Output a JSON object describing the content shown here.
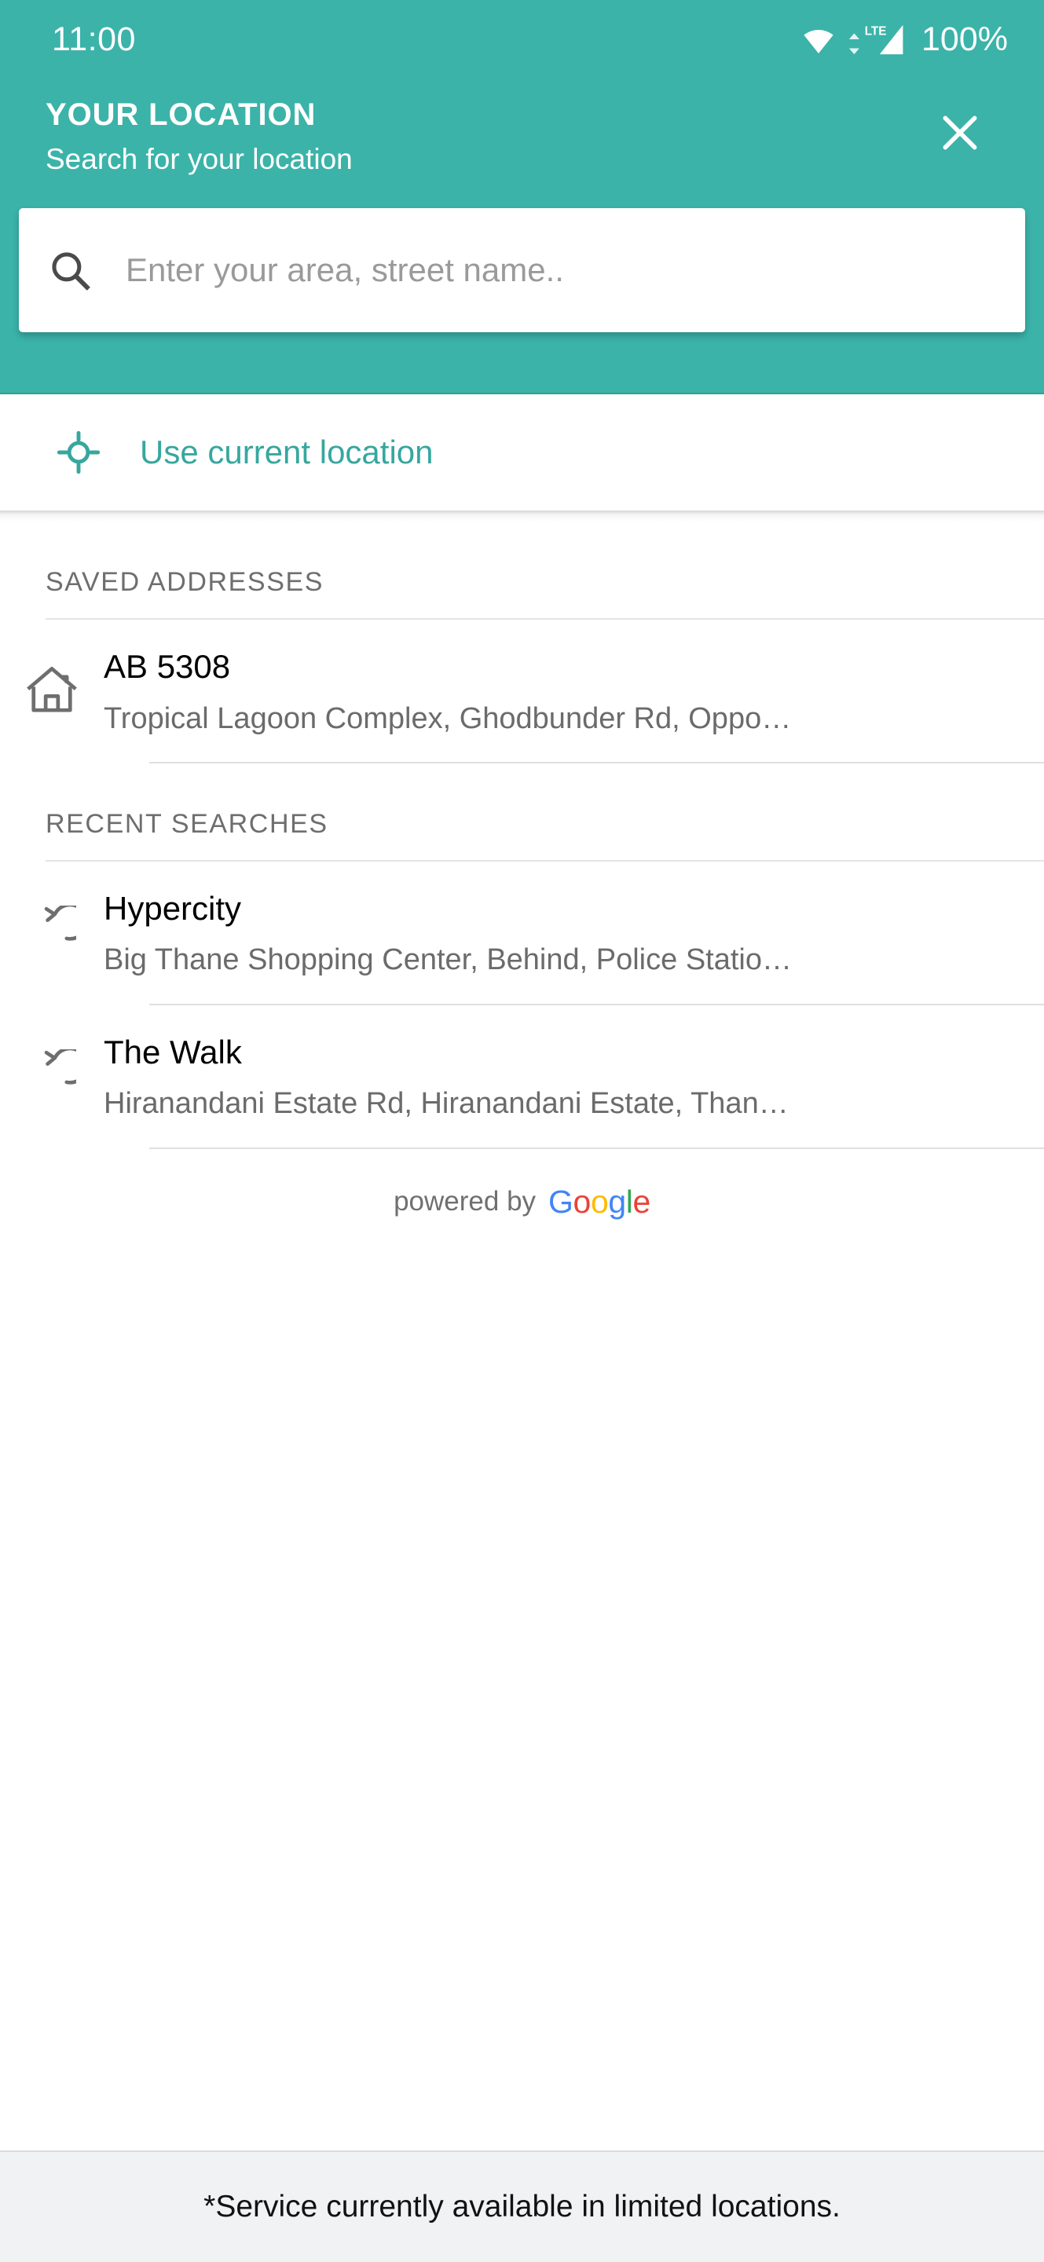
{
  "theme": {
    "accent": "#3BB3A9",
    "accent_text": "#37A79E",
    "footer_bg": "#F0F2F3",
    "body_text": "#000000",
    "muted_text": "#6B6B6B",
    "section_text": "#6E6E6E",
    "placeholder": "#9A9A9A"
  },
  "status_bar": {
    "time": "11:00",
    "battery": "100%",
    "network_type": "LTE",
    "icons": [
      "wifi-icon",
      "cellular-signal-icon",
      "battery-percent-label"
    ]
  },
  "header": {
    "title": "YOUR LOCATION",
    "subtitle": "Search for your location",
    "close_icon": "close-icon"
  },
  "search": {
    "icon": "search-icon",
    "value": "",
    "placeholder": "Enter your area, street name.."
  },
  "current_location": {
    "icon": "gps-crosshair-icon",
    "label": "Use current location"
  },
  "saved_addresses": {
    "heading": "SAVED ADDRESSES",
    "items": [
      {
        "icon": "home-icon",
        "title": "AB 5308",
        "subtitle": "Tropical Lagoon Complex, Ghodbunder Rd, Oppo…"
      }
    ]
  },
  "recent_searches": {
    "heading": "RECENT SEARCHES",
    "items": [
      {
        "icon": "history-refresh-icon",
        "title": "Hypercity",
        "subtitle": "Big Thane Shopping Center, Behind, Police Statio…"
      },
      {
        "icon": "history-refresh-icon",
        "title": "The Walk",
        "subtitle": "Hiranandani Estate Rd, Hiranandani Estate, Than…"
      }
    ]
  },
  "attribution": {
    "prefix": "powered by",
    "brand_letters": [
      {
        "char": "G",
        "color": "#4285F4"
      },
      {
        "char": "o",
        "color": "#EA4335"
      },
      {
        "char": "o",
        "color": "#FBBC05"
      },
      {
        "char": "g",
        "color": "#4285F4"
      },
      {
        "char": "l",
        "color": "#34A853"
      },
      {
        "char": "e",
        "color": "#EA4335"
      }
    ]
  },
  "footer": {
    "note": "*Service currently available in limited locations."
  }
}
